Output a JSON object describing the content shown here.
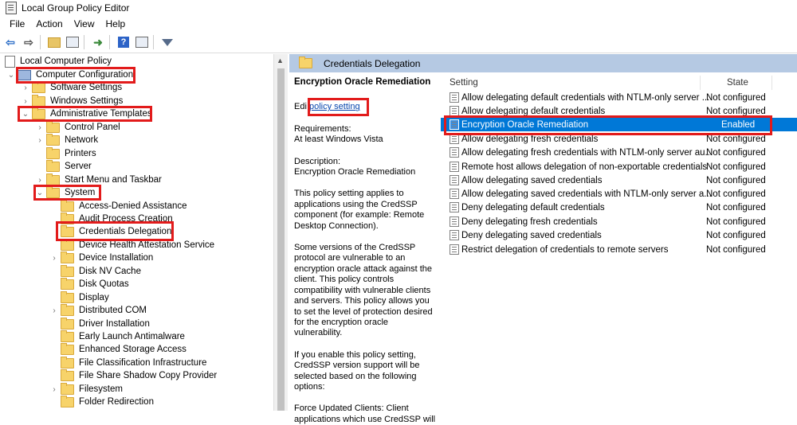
{
  "window": {
    "title": "Local Group Policy Editor"
  },
  "menu": [
    "File",
    "Action",
    "View",
    "Help"
  ],
  "toolbar": {
    "icons": [
      "back-arrow-icon",
      "forward-arrow-icon",
      "up-folder-icon",
      "show-hide-tree-icon",
      "export-list-icon",
      "help-icon",
      "extended-view-icon",
      "filter-icon"
    ]
  },
  "tree": {
    "items": [
      {
        "label": "Local Computer Policy"
      },
      {
        "label": "Computer Configuration"
      },
      {
        "label": "Software Settings"
      },
      {
        "label": "Windows Settings"
      },
      {
        "label": "Administrative Templates"
      },
      {
        "label": "Control Panel"
      },
      {
        "label": "Network"
      },
      {
        "label": "Printers"
      },
      {
        "label": "Server"
      },
      {
        "label": "Start Menu and Taskbar"
      },
      {
        "label": "System"
      },
      {
        "label": "Access-Denied Assistance"
      },
      {
        "label": "Audit Process Creation"
      },
      {
        "label": "Credentials Delegation"
      },
      {
        "label": "Device Health Attestation Service"
      },
      {
        "label": "Device Installation"
      },
      {
        "label": "Disk NV Cache"
      },
      {
        "label": "Disk Quotas"
      },
      {
        "label": "Display"
      },
      {
        "label": "Distributed COM"
      },
      {
        "label": "Driver Installation"
      },
      {
        "label": "Early Launch Antimalware"
      },
      {
        "label": "Enhanced Storage Access"
      },
      {
        "label": "File Classification Infrastructure"
      },
      {
        "label": "File Share Shadow Copy Provider"
      },
      {
        "label": "Filesystem"
      },
      {
        "label": "Folder Redirection"
      }
    ]
  },
  "detail": {
    "header": "Credentials Delegation",
    "description": {
      "title": "Encryption Oracle Remediation",
      "edit_prefix": "Edi",
      "edit_link": "policy setting",
      "requirements_label": "Requirements:",
      "requirements_value": "At least Windows Vista",
      "description_label": "Description:",
      "description_value": "Encryption Oracle Remediation",
      "para1": "This policy setting applies to applications using the CredSSP component (for example: Remote Desktop Connection).",
      "para2": "Some versions of the CredSSP protocol are vulnerable to an encryption oracle attack against the client.  This policy controls compatibility with vulnerable clients and servers.  This policy allows you to set the level of protection desired for the encryption oracle vulnerability.",
      "para3": "If you enable this policy setting, CredSSP version support will be selected based on the following options:",
      "para4": "Force Updated Clients: Client applications which use CredSSP will"
    },
    "list": {
      "col_setting": "Setting",
      "col_state": "State",
      "rows": [
        {
          "name": "Allow delegating default credentials with NTLM-only server ...",
          "state": "Not configured"
        },
        {
          "name": "Allow delegating default credentials",
          "state": "Not configured"
        },
        {
          "name": "Encryption Oracle Remediation",
          "state": "Enabled"
        },
        {
          "name": "Allow delegating fresh credentials",
          "state": "Not configured"
        },
        {
          "name": "Allow delegating fresh credentials with NTLM-only server au...",
          "state": "Not configured"
        },
        {
          "name": "Remote host allows delegation of non-exportable credentials",
          "state": "Not configured"
        },
        {
          "name": "Allow delegating saved credentials",
          "state": "Not configured"
        },
        {
          "name": "Allow delegating saved credentials with NTLM-only server a...",
          "state": "Not configured"
        },
        {
          "name": "Deny delegating default credentials",
          "state": "Not configured"
        },
        {
          "name": "Deny delegating fresh credentials",
          "state": "Not configured"
        },
        {
          "name": "Deny delegating saved credentials",
          "state": "Not configured"
        },
        {
          "name": "Restrict delegation of credentials to remote servers",
          "state": "Not configured"
        }
      ]
    }
  },
  "colors": {
    "selection": "#0078d7",
    "header": "#b5c9e3",
    "highlight_box": "#e21b1b"
  }
}
